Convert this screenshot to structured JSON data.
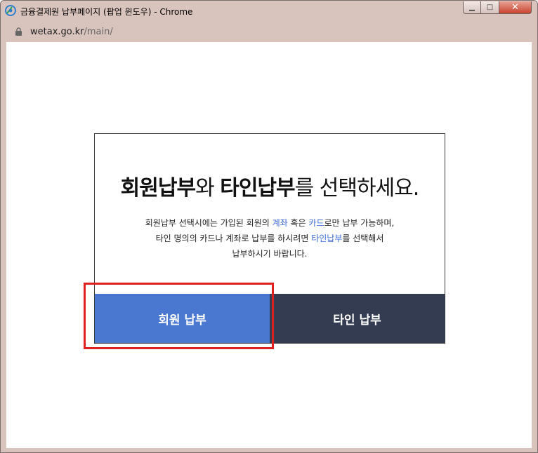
{
  "window": {
    "title": "금융결제원 납부페이지 (팝업 윈도우) - Chrome",
    "controls": {
      "minimize": "▁",
      "maximize": "□",
      "close": "✕"
    }
  },
  "address": {
    "host": "wetax.go.kr",
    "path": "/main/"
  },
  "card": {
    "heading": {
      "part1": "회원납부",
      "part2": "와 ",
      "part3": "타인납부",
      "part4": "를 선택하세요."
    },
    "description": {
      "line1_a": "회원납부 선택시에는 가입된 회원의 ",
      "line1_b": "계좌",
      "line1_c": " 혹은 ",
      "line1_d": "카드",
      "line1_e": "로만 납부 가능하며,",
      "line2_a": "타인 명의의 카드나 계좌로 납부를 하시려면 ",
      "line2_b": "타인납부",
      "line2_c": "를 선택해서",
      "line3": "납부하시기 바랍니다."
    },
    "buttons": {
      "member": "회원 납부",
      "other": "타인 납부"
    }
  },
  "colors": {
    "member_button": "#4a78d0",
    "other_button": "#343c52",
    "highlight_link": "#3b6bd6",
    "annotation_box": "#e01f1f"
  },
  "icons": {
    "app": "chrome-logo-icon",
    "lock": "lock-icon"
  }
}
